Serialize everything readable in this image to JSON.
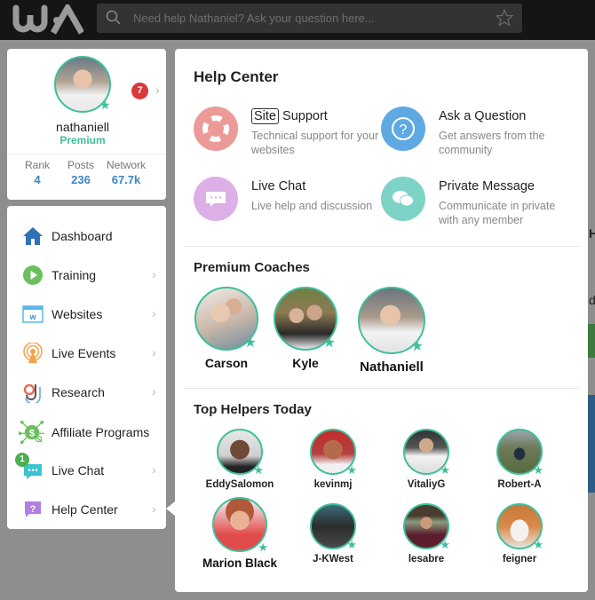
{
  "app": {
    "logo": "WA",
    "search": {
      "placeholder": "Need help Nathaniel? Ask your question here..."
    }
  },
  "profile": {
    "username": "nathaniell",
    "membership": "Premium",
    "notifications": "7",
    "stats": [
      {
        "label": "Rank",
        "value": "4"
      },
      {
        "label": "Posts",
        "value": "236"
      },
      {
        "label": "Network",
        "value": "67.7k"
      }
    ]
  },
  "menu": {
    "items": [
      {
        "label": "Dashboard",
        "icon": "home-icon",
        "has_chevron": false
      },
      {
        "label": "Training",
        "icon": "play-icon",
        "has_chevron": true
      },
      {
        "label": "Websites",
        "icon": "website-icon",
        "has_chevron": true
      },
      {
        "label": "Live Events",
        "icon": "broadcast-icon",
        "has_chevron": true
      },
      {
        "label": "Research",
        "icon": "research-icon",
        "has_chevron": true
      },
      {
        "label": "Affiliate Programs",
        "icon": "affiliate-icon",
        "has_chevron": false
      },
      {
        "label": "Live Chat",
        "icon": "chat-icon",
        "has_chevron": true,
        "badge": "1"
      },
      {
        "label": "Help Center",
        "icon": "help-icon",
        "has_chevron": true
      }
    ]
  },
  "help_center": {
    "title": "Help Center",
    "options": [
      {
        "title_boxed": "Site",
        "title": "Support",
        "desc": "Technical support for your websites",
        "icon": "lifebuoy-icon",
        "color": "#ec9a98"
      },
      {
        "title": "Ask a Question",
        "desc": "Get answers from the community",
        "icon": "question-icon",
        "color": "#5fa9e3"
      },
      {
        "title": "Live Chat",
        "desc": "Live help and discussion",
        "icon": "chat-bubble-icon",
        "color": "#dcb0e6"
      },
      {
        "title": "Private Message",
        "desc": "Communicate in private with any member",
        "icon": "message-bubbles-icon",
        "color": "#7dd3c6"
      }
    ],
    "coaches_title": "Premium Coaches",
    "coaches": [
      {
        "name": "Carson"
      },
      {
        "name": "Kyle"
      },
      {
        "name": "Nathaniell"
      }
    ],
    "helpers_title": "Top Helpers Today",
    "helpers": [
      {
        "name": "EddySalomon"
      },
      {
        "name": "kevinmj"
      },
      {
        "name": "VitaliyG"
      },
      {
        "name": "Robert-A"
      },
      {
        "name": "Marion Black"
      },
      {
        "name": "J-KWest"
      },
      {
        "name": "lesabre"
      },
      {
        "name": "feigner"
      }
    ]
  },
  "colors": {
    "accent_green": "#3ebf9a",
    "link_blue": "#3a85c7",
    "badge_red": "#d9393c"
  }
}
